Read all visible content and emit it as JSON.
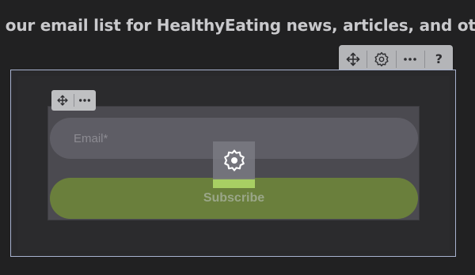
{
  "header": {
    "text": "n our email list for HealthyEating news, articles, and other cool stu"
  },
  "toolbar": {
    "move_icon": "move-arrows-icon",
    "settings_icon": "gear-icon",
    "more_icon": "more-dots-icon",
    "help_label": "?"
  },
  "form_toolbar": {
    "move_icon": "move-arrows-icon",
    "more_icon": "more-dots-icon"
  },
  "form": {
    "email_placeholder": "Email*",
    "subscribe_label": "Subscribe",
    "settings_icon": "gear-icon"
  },
  "colors": {
    "background": "#212122",
    "subscribe_button": "#6a7f3c",
    "selection_border": "#a7b2cf",
    "settings_highlight": "#a8cf63"
  }
}
